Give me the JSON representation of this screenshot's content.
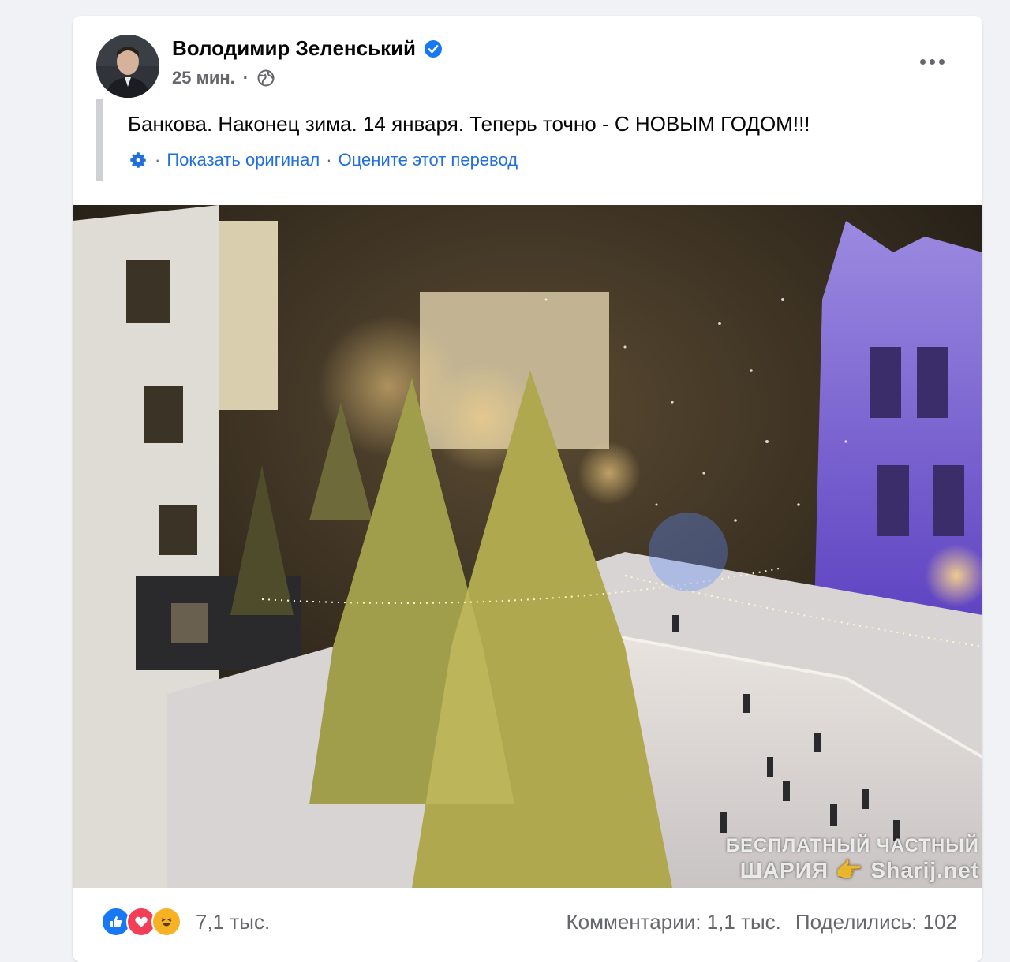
{
  "post": {
    "author": "Володимир Зеленський",
    "time": "25 мин.",
    "separator": "·",
    "text": "Банкова. Наконец зима. 14 января. Теперь точно - С НОВЫМ ГОДОМ!!!",
    "translation": {
      "show_original": "Показать оригинал",
      "rate": "Оцените этот перевод",
      "dot": "·"
    }
  },
  "watermark": {
    "line1": "БЕСПЛАТНЫЙ ЧАСТНЫЙ",
    "line2": "ШАРИЯ 👉 Sharij.net"
  },
  "footer": {
    "reactions_count": "7,1 тыс.",
    "comments": "Комментарии: 1,1 тыс.",
    "shares": "Поделились: 102"
  },
  "icons": {
    "verified": "verified-badge-icon",
    "globe": "globe-icon",
    "gear": "gear-icon",
    "more": "more-dots-icon",
    "like": "like-reaction-icon",
    "love": "love-reaction-icon",
    "haha": "haha-reaction-icon"
  },
  "colors": {
    "link": "#216fdb",
    "secondary_text": "#65676b",
    "like": "#1877f2",
    "love": "#f33e58",
    "haha": "#f7b125"
  }
}
